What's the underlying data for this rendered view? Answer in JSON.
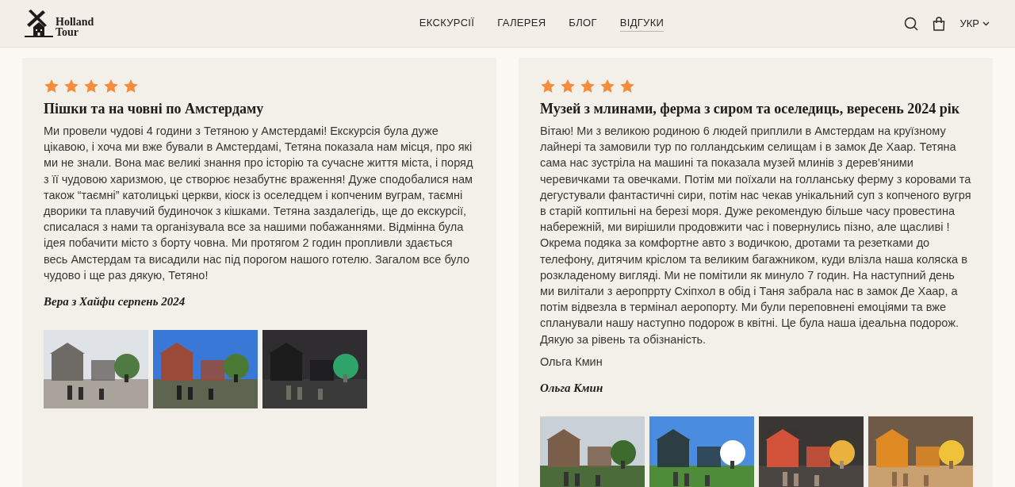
{
  "header": {
    "logo_text": [
      "Holland",
      "Tour"
    ],
    "nav": [
      {
        "label": "ЕКСКУРСІЇ",
        "selected": false
      },
      {
        "label": "ГАЛЕРЕЯ",
        "selected": false
      },
      {
        "label": "БЛОГ",
        "selected": false
      },
      {
        "label": "ВІДГУКИ",
        "selected": true
      }
    ],
    "language": "УКР"
  },
  "reviews": [
    {
      "stars": 5,
      "title": "Пішки та на човні по Амстердаму",
      "paragraphs": [
        "Ми провели чудові 4 години з Тетяною у Амстердамі! Екскурсія була дуже цікавою, і хоча ми вже бували в Амстердамі, Тетяна показала нам місця, про які ми не знали. Вона має великі знання про історію та сучасне життя міста, і поряд з її чудовою харизмою, це створює незабутнє враження! Дуже сподобалися нам також “таємні” католицькі церкви, кіоск із оселедцем і копченим вуграм, таємні дворики та плавучий будиночок з кішками. Тетяна заздалегідь, ще до екскурсії, списалася з нами та організувала все за нашими побажаннями. Відмінна була ідея побачити місто з борту човна. Ми протягом 2 годин пропливли здається весь Амстердам та висадили нас під порогом нашого готелю. Загалом все було чудово і ще раз дякую, Тетяно!"
      ],
      "author": "Вера з Хайфи серпень 2024",
      "photos": [
        {
          "kind": "picture"
        },
        {
          "kind": "picture"
        },
        {
          "kind": "picture"
        }
      ]
    },
    {
      "stars": 5,
      "title": "Музей з млинами, ферма з сиром та оселедиць, вересень 2024 рік",
      "paragraphs": [
        "Вітаю! Ми з великою родиною 6 людей приплили в Амстердам на круїзному лайнері та замовили тур по голландським селищам і в замок Де Хаар. Тетяна сама нас зустріла на машині та показала музей млинів з дерев'яними черевичками та овечками. Потім ми поїхали на голланську ферму з коровами та дегустували фантастичні сири, потім нас чекав унікальний суп з копченого вугря в старій коптильні на березі моря. Дуже рекомендую більше часу провестина набережній, ми вирішили продовжити час і повернулись пізно, але щасливі ! Окрема подяка за комфортне авто з водичкою, дротами та резетками до телефону, дитячим кріслом та великим багажником, куди влізла наша коляска в розкладеному вигляді. Ми не помітили як минуло 7 годин. На наступний день ми вилітали з аеропррту Схіпхол в обід і Таня забрала нас в замок Де Хаар, а потім відвезла в термінал аеропорту. Ми були переповнені емоціями та вже спланували нашу наступно подорож в квітні. Це була наша ідеальна подорож. Дякую за рівень та обізнаність.",
        "Ольга Кмин"
      ],
      "author": "Ольга Кмин",
      "photos": [
        {
          "kind": "picture"
        },
        {
          "kind": "picture"
        },
        {
          "kind": "picture"
        },
        {
          "kind": "picture"
        }
      ]
    }
  ]
}
